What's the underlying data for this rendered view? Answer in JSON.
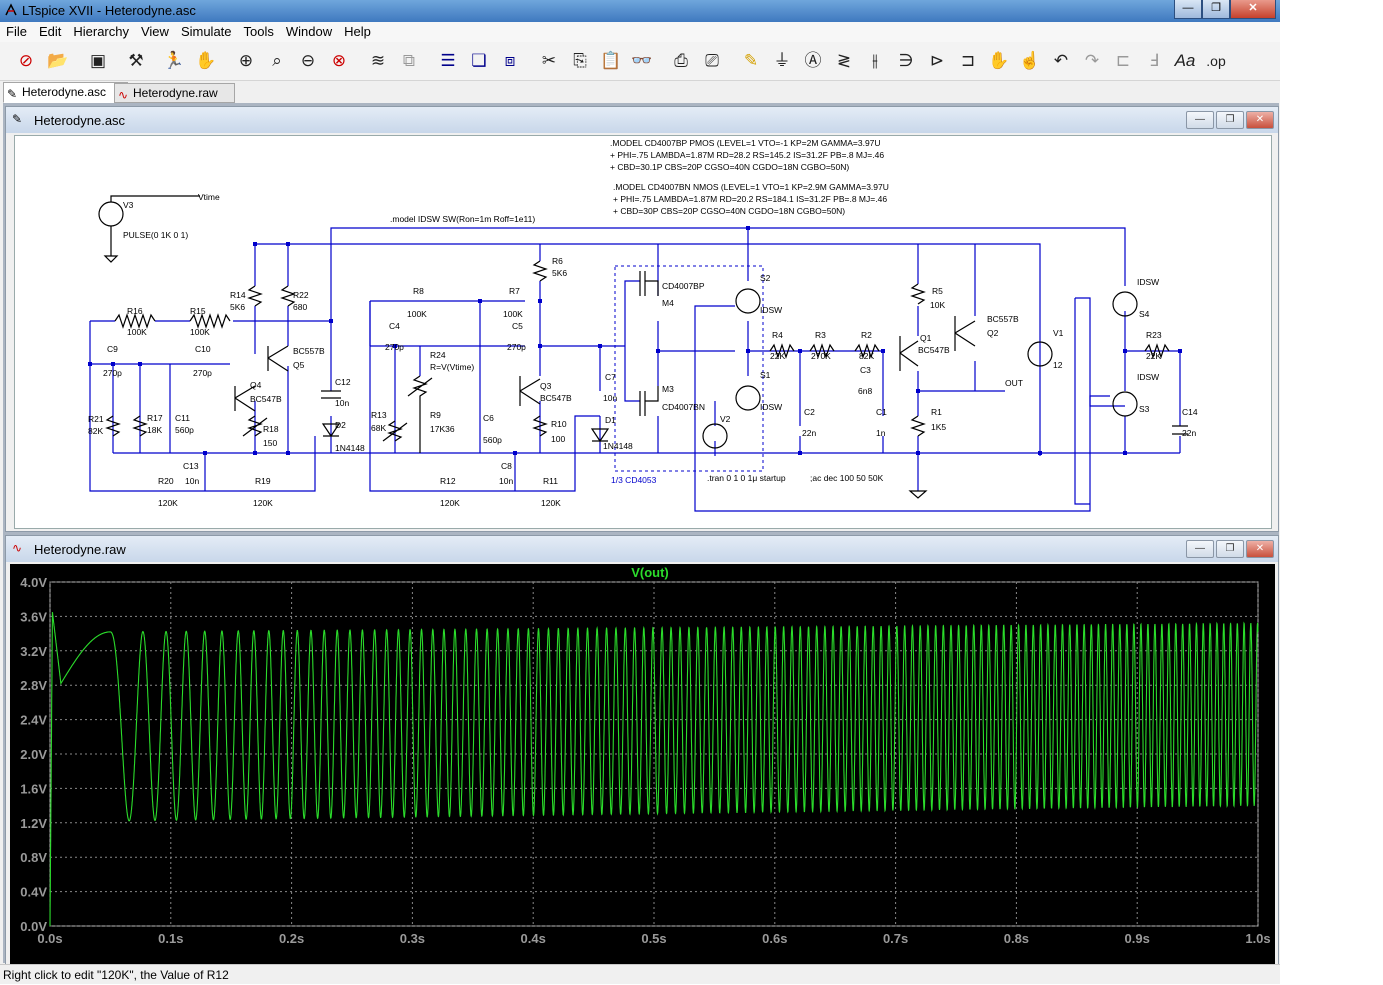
{
  "window": {
    "title": "LTspice XVII - Heterodyne.asc",
    "buttons": [
      "—",
      "❐",
      "✕"
    ]
  },
  "menu": [
    "File",
    "Edit",
    "Hierarchy",
    "View",
    "Simulate",
    "Tools",
    "Window",
    "Help"
  ],
  "toolbar_icons": [
    "new-schematic-icon",
    "open-icon",
    "save-icon",
    "control-panel-icon",
    "run-icon",
    "halt-icon",
    "zoom-in-icon",
    "pan-icon",
    "zoom-out-icon",
    "zoom-fit-icon",
    "autorange-icon",
    "undo-zoom-icon",
    "tile-horizontal-icon",
    "cascade-icon",
    "tile-vertical-icon",
    "cut-icon",
    "copy-icon",
    "paste-icon",
    "find-icon",
    "print-icon",
    "print-setup-icon",
    "draw-wire-icon",
    "ground-icon",
    "label-net-icon",
    "resistor-icon",
    "capacitor-icon",
    "inductor-icon",
    "diode-icon",
    "component-icon",
    "move-icon",
    "drag-icon",
    "undo-icon",
    "redo-icon",
    "rotate-icon",
    "mirror-icon",
    "text-icon",
    "spice-directive-icon"
  ],
  "tabs": [
    {
      "label": "Heterodyne.asc"
    },
    {
      "label": "Heterodyne.raw"
    }
  ],
  "schematic_window": {
    "title": "Heterodyne.asc",
    "buttons": [
      "—",
      "❐",
      "✕"
    ]
  },
  "plot_window": {
    "title": "Heterodyne.raw",
    "buttons": [
      "—",
      "❐",
      "✕"
    ]
  },
  "schematic_text": {
    "directives": [
      ".MODEL CD4007BP PMOS (LEVEL=1 VTO=-1 KP=2M GAMMA=3.97U",
      "+ PHI=.75 LAMBDA=1.87M RD=28.2 RS=145.2 IS=31.2F PB=.8 MJ=.46",
      "+ CBD=30.1P CBS=20P CGSO=40N CGDO=18N CGBO=50N)",
      ".MODEL CD4007BN NMOS (LEVEL=1 VTO=1 KP=2.9M GAMMA=3.97U",
      "+ PHI=.75 LAMBDA=1.87M RD=20.2 RS=184.1 IS=31.2F PB=.8 MJ=.46",
      "+ CBD=30P CBS=20P CGSO=40N CGDO=18N CGBO=50N)",
      ".model IDSW SW(Ron=1m Roff=1e11)",
      ".tran 0 1 0 1μ startup",
      ";ac dec 100 50 50K",
      "1/3 CD4053"
    ],
    "labels": [
      "V3",
      "Vtime",
      "PULSE(0 1K 0 1)",
      "R14",
      "5K6",
      "R22",
      "680",
      "BC557B",
      "Q5",
      "R16",
      "100K",
      "R15",
      "100K",
      "C9",
      "270p",
      "C10",
      "270p",
      "Q4",
      "BC547B",
      "R21",
      "82K",
      "R17",
      "18K",
      "C11",
      "560p",
      "R18",
      "150",
      "C12",
      "10n",
      "D2",
      "1N4148",
      "C13",
      "10n",
      "R20",
      "120K",
      "R19",
      "120K",
      "R8",
      "100K",
      "R7",
      "100K",
      "R6",
      "5K6",
      "C4",
      "270p",
      "C5",
      "270p",
      "R24",
      "R=V(Vtime)",
      "R13",
      "68K",
      "R9",
      "17K36",
      "C6",
      "560p",
      "Q3",
      "BC547B",
      "R10",
      "100",
      "C7",
      "10n",
      "D1",
      "1N4148",
      "C8",
      "10n",
      "R12",
      "120K",
      "R11",
      "120K",
      "CD4007BP",
      "M4",
      "CD4007BN",
      "M3",
      "S2",
      "IDSW",
      "S1",
      "IDSW",
      "V2",
      "R4",
      "22K",
      "R3",
      "270K",
      "R2",
      "82K",
      "C3",
      "6n8",
      "C2",
      "22n",
      "C1",
      "1n",
      "R5",
      "10K",
      "Q1",
      "BC547B",
      "R1",
      "1K5",
      "BC557B",
      "Q2",
      "OUT",
      "V1",
      "12",
      "IDSW",
      "S4",
      "IDSW",
      "S3",
      "R23",
      "22K",
      "C14",
      "22n"
    ]
  },
  "chart_data": {
    "type": "line",
    "title": "V(out)",
    "xlabel": "",
    "ylabel": "",
    "xlim": [
      0,
      1
    ],
    "ylim": [
      0,
      4
    ],
    "x_ticks": [
      "0.0s",
      "0.1s",
      "0.2s",
      "0.3s",
      "0.4s",
      "0.5s",
      "0.6s",
      "0.7s",
      "0.8s",
      "0.9s",
      "1.0s"
    ],
    "y_ticks": [
      "0.0V",
      "0.4V",
      "0.8V",
      "1.2V",
      "1.6V",
      "2.0V",
      "2.4V",
      "2.8V",
      "3.2V",
      "3.6V",
      "4.0V"
    ],
    "grid": true,
    "colors": {
      "trace": "#2bdc2b",
      "background": "#000000",
      "grid": "#888888",
      "title": "#2bdc2b"
    },
    "series": [
      {
        "name": "V(out)",
        "description_points": [
          [
            0.0,
            0.0
          ],
          [
            0.002,
            3.65
          ],
          [
            0.009,
            2.82
          ],
          [
            0.05,
            3.42
          ],
          [
            0.087,
            1.22
          ],
          [
            0.115,
            3.4
          ],
          [
            0.143,
            1.22
          ],
          [
            0.16,
            3.42
          ],
          [
            0.178,
            1.2
          ],
          [
            0.5,
            3.45
          ],
          [
            1.0,
            3.5
          ]
        ],
        "envelope_high_start": 3.42,
        "envelope_high_end": 3.52,
        "envelope_low_start": 1.22,
        "envelope_low_end": 1.4,
        "freq_start_hz": 14,
        "freq_end_hz": 180
      }
    ]
  },
  "status": {
    "text": "Right click to edit \"120K\", the Value of R12"
  }
}
